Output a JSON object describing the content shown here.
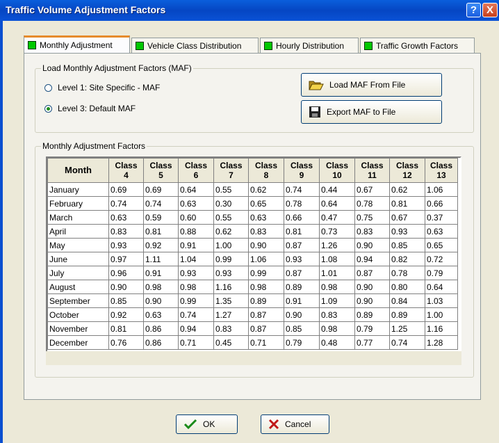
{
  "window": {
    "title": "Traffic Volume Adjustment Factors",
    "help_label": "?",
    "close_label": "X"
  },
  "tabs": [
    {
      "label": "Monthly Adjustment",
      "active": true
    },
    {
      "label": "Vehicle Class Distribution",
      "active": false
    },
    {
      "label": "Hourly Distribution",
      "active": false
    },
    {
      "label": "Traffic Growth Factors",
      "active": false
    }
  ],
  "load_group": {
    "legend": "Load Monthly Adjustment Factors (MAF)",
    "options": [
      {
        "label": "Level 1: Site Specific - MAF",
        "selected": false
      },
      {
        "label": "Level 3: Default MAF",
        "selected": true
      }
    ],
    "load_button": "Load  MAF From File",
    "export_button": "Export MAF to File"
  },
  "factors_group": {
    "legend": "Monthly Adjustment Factors",
    "month_header": "Month",
    "class_headers": [
      {
        "line1": "Class",
        "line2": "4"
      },
      {
        "line1": "Class",
        "line2": "5"
      },
      {
        "line1": "Class",
        "line2": "6"
      },
      {
        "line1": "Class",
        "line2": "7"
      },
      {
        "line1": "Class",
        "line2": "8"
      },
      {
        "line1": "Class",
        "line2": "9"
      },
      {
        "line1": "Class",
        "line2": "10"
      },
      {
        "line1": "Class",
        "line2": "11"
      },
      {
        "line1": "Class",
        "line2": "12"
      },
      {
        "line1": "Class",
        "line2": "13"
      }
    ],
    "rows": [
      {
        "month": "January",
        "values": [
          "0.69",
          "0.69",
          "0.64",
          "0.55",
          "0.62",
          "0.74",
          "0.44",
          "0.67",
          "0.62",
          "1.06"
        ]
      },
      {
        "month": "February",
        "values": [
          "0.74",
          "0.74",
          "0.63",
          "0.30",
          "0.65",
          "0.78",
          "0.64",
          "0.78",
          "0.81",
          "0.66"
        ]
      },
      {
        "month": "March",
        "values": [
          "0.63",
          "0.59",
          "0.60",
          "0.55",
          "0.63",
          "0.66",
          "0.47",
          "0.75",
          "0.67",
          "0.37"
        ]
      },
      {
        "month": "April",
        "values": [
          "0.83",
          "0.81",
          "0.88",
          "0.62",
          "0.83",
          "0.81",
          "0.73",
          "0.83",
          "0.93",
          "0.63"
        ]
      },
      {
        "month": "May",
        "values": [
          "0.93",
          "0.92",
          "0.91",
          "1.00",
          "0.90",
          "0.87",
          "1.26",
          "0.90",
          "0.85",
          "0.65"
        ]
      },
      {
        "month": "June",
        "values": [
          "0.97",
          "1.11",
          "1.04",
          "0.99",
          "1.06",
          "0.93",
          "1.08",
          "0.94",
          "0.82",
          "0.72"
        ]
      },
      {
        "month": "July",
        "values": [
          "0.96",
          "0.91",
          "0.93",
          "0.93",
          "0.99",
          "0.87",
          "1.01",
          "0.87",
          "0.78",
          "0.79"
        ]
      },
      {
        "month": "August",
        "values": [
          "0.90",
          "0.98",
          "0.98",
          "1.16",
          "0.98",
          "0.89",
          "0.98",
          "0.90",
          "0.80",
          "0.64"
        ]
      },
      {
        "month": "September",
        "values": [
          "0.85",
          "0.90",
          "0.99",
          "1.35",
          "0.89",
          "0.91",
          "1.09",
          "0.90",
          "0.84",
          "1.03"
        ]
      },
      {
        "month": "October",
        "values": [
          "0.92",
          "0.63",
          "0.74",
          "1.27",
          "0.87",
          "0.90",
          "0.83",
          "0.89",
          "0.89",
          "1.00"
        ]
      },
      {
        "month": "November",
        "values": [
          "0.81",
          "0.86",
          "0.94",
          "0.83",
          "0.87",
          "0.85",
          "0.98",
          "0.79",
          "1.25",
          "1.16"
        ]
      },
      {
        "month": "December",
        "values": [
          "0.76",
          "0.86",
          "0.71",
          "0.45",
          "0.71",
          "0.79",
          "0.48",
          "0.77",
          "0.74",
          "1.28"
        ]
      }
    ]
  },
  "footer": {
    "ok_label": "OK",
    "cancel_label": "Cancel"
  },
  "colors": {
    "titlebar": "#0546c3",
    "tab_indicator": "#00c800",
    "active_tab_accent": "#e68b2c",
    "dialog_bg": "#ece9d8"
  },
  "icons": {
    "load": "folder-open-icon",
    "export": "floppy-disk-icon",
    "ok": "checkmark-icon",
    "cancel": "x-mark-icon"
  }
}
